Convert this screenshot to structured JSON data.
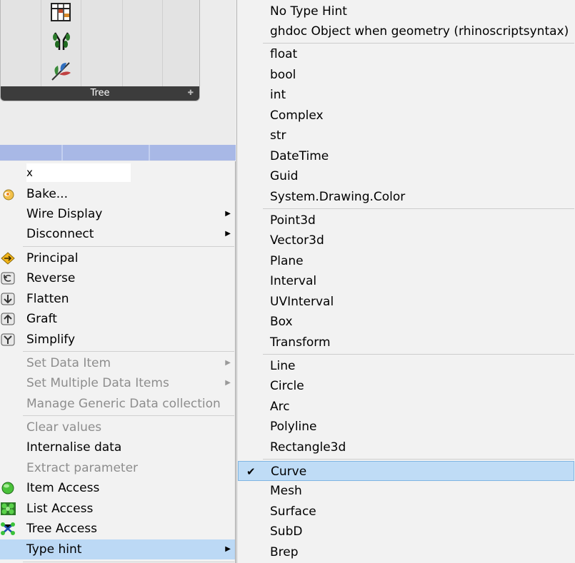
{
  "tree_panel": {
    "caption": "Tree",
    "caption_arrow": "✚"
  },
  "left_menu": {
    "name_value": "x",
    "items": [
      {
        "label": "Bake...",
        "icon": "bake-icon"
      },
      {
        "label": "Wire Display",
        "submenu": true
      },
      {
        "label": "Disconnect",
        "submenu": true
      },
      {
        "label": "Principal",
        "icon": "principal-icon"
      },
      {
        "label": "Reverse",
        "icon": "reverse-icon"
      },
      {
        "label": "Flatten",
        "icon": "flatten-icon"
      },
      {
        "label": "Graft",
        "icon": "graft-icon"
      },
      {
        "label": "Simplify",
        "icon": "simplify-icon"
      },
      {
        "label": "Set Data Item",
        "disabled": true,
        "submenu": true
      },
      {
        "label": "Set Multiple Data Items",
        "disabled": true,
        "submenu": true
      },
      {
        "label": "Manage Generic Data collection",
        "disabled": true
      },
      {
        "label": "Clear values",
        "disabled": true
      },
      {
        "label": "Internalise data"
      },
      {
        "label": "Extract parameter",
        "disabled": true
      },
      {
        "label": "Item Access",
        "icon": "item-access-icon"
      },
      {
        "label": "List Access",
        "icon": "list-access-icon"
      },
      {
        "label": "Tree Access",
        "icon": "tree-access-icon"
      },
      {
        "label": "Type hint",
        "submenu": true,
        "highlighted": true
      }
    ],
    "submenu_arrow": "▶"
  },
  "type_hint_menu": {
    "check_glyph": "✔",
    "items": [
      "No Type Hint",
      "ghdoc Object when geometry (rhinoscriptsyntax)",
      "float",
      "bool",
      "int",
      "Complex",
      "str",
      "DateTime",
      "Guid",
      "System.Drawing.Color",
      "Point3d",
      "Vector3d",
      "Plane",
      "Interval",
      "UVInterval",
      "Box",
      "Transform",
      "Line",
      "Circle",
      "Arc",
      "Polyline",
      "Rectangle3d",
      "Curve",
      "Mesh",
      "Surface",
      "SubD",
      "Brep"
    ],
    "checked": "Curve"
  },
  "colors": {
    "menu_bg": "#f2f2f2",
    "highlight": "#bcd9f5",
    "checked_border": "#7fb5e2",
    "disabled_text": "#8d8d8d",
    "canvas_strip": "#a8b8e6"
  }
}
